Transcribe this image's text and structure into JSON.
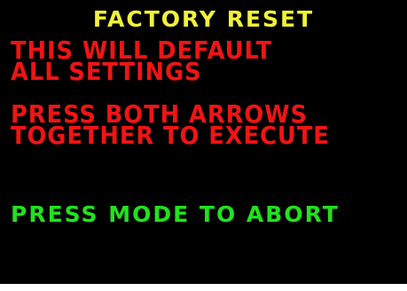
{
  "screen": {
    "title": "FACTORY RESET",
    "warning_line_1": "THIS WILL DEFAULT",
    "warning_line_2": "ALL SETTINGS",
    "instruction_line_1": "PRESS BOTH ARROWS",
    "instruction_line_2": "TOGETHER TO EXECUTE",
    "abort_text": "PRESS MODE TO ABORT"
  },
  "colors": {
    "background": "#000000",
    "title": "#f2f23a",
    "warning": "#f01414",
    "abort": "#22e11e"
  }
}
